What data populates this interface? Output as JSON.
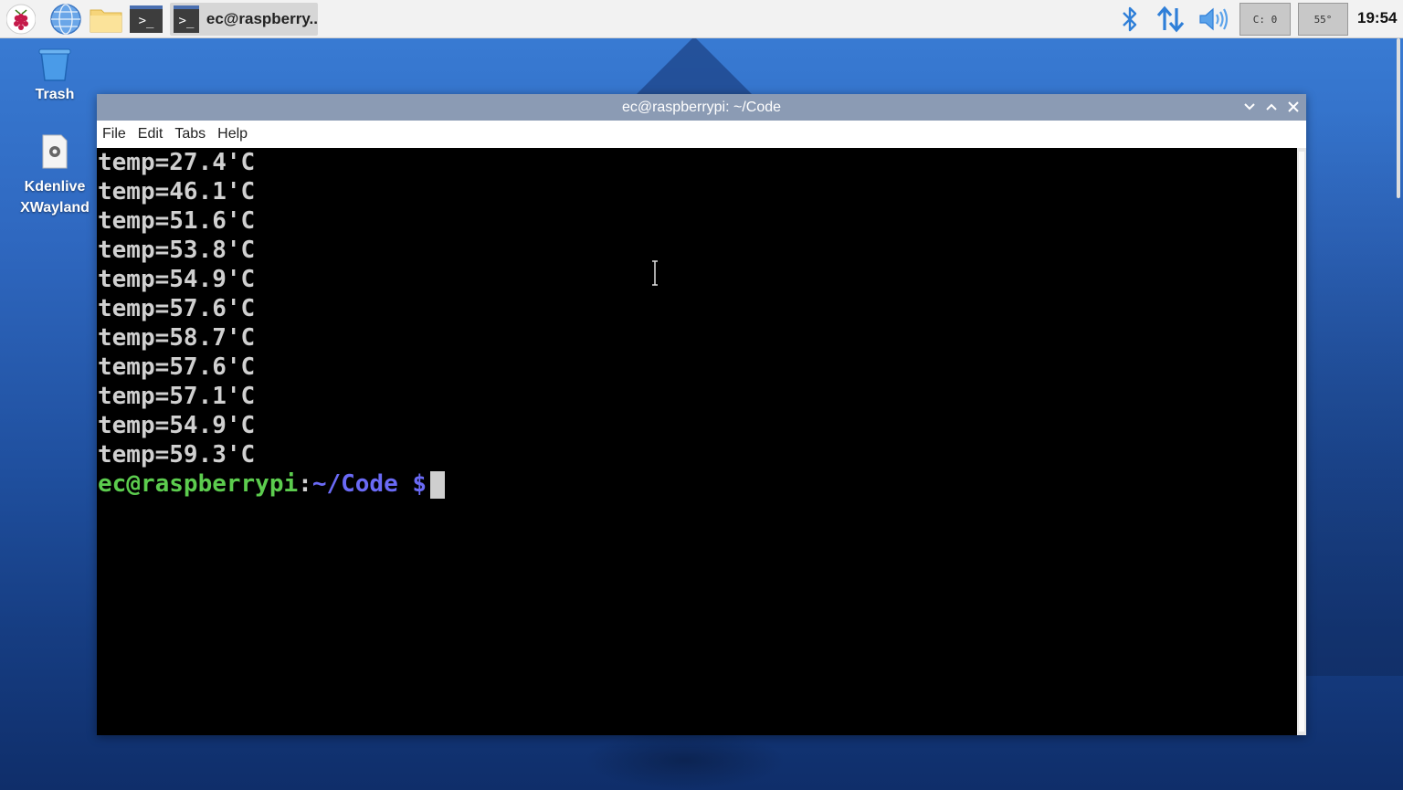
{
  "taskbar": {
    "window_task_label": "ec@raspberry..",
    "cpu_label": "C: 0",
    "temp_label": "55°",
    "clock": "19:54",
    "term_glyph": ">_"
  },
  "desktop": {
    "icons": [
      {
        "label": "Trash",
        "icon": "trash-icon"
      },
      {
        "label_line1": "Kdenlive",
        "label_line2": "XWayland",
        "icon": "app-gear-icon"
      }
    ]
  },
  "window": {
    "title": "ec@raspberrypi: ~/Code",
    "menu": [
      "File",
      "Edit",
      "Tabs",
      "Help"
    ]
  },
  "terminal": {
    "lines": [
      "temp=27.4'C",
      "temp=46.1'C",
      "temp=51.6'C",
      "temp=53.8'C",
      "temp=54.9'C",
      "temp=57.6'C",
      "temp=58.7'C",
      "temp=57.6'C",
      "temp=57.1'C",
      "temp=54.9'C",
      "temp=59.3'C"
    ],
    "prompt_user": "ec@raspberrypi",
    "prompt_sep": ":",
    "prompt_path": "~/Code $"
  },
  "colors": {
    "prompt_user": "#5ccc4e",
    "prompt_path": "#6a6af5",
    "titlebar": "#8b9bb4"
  }
}
